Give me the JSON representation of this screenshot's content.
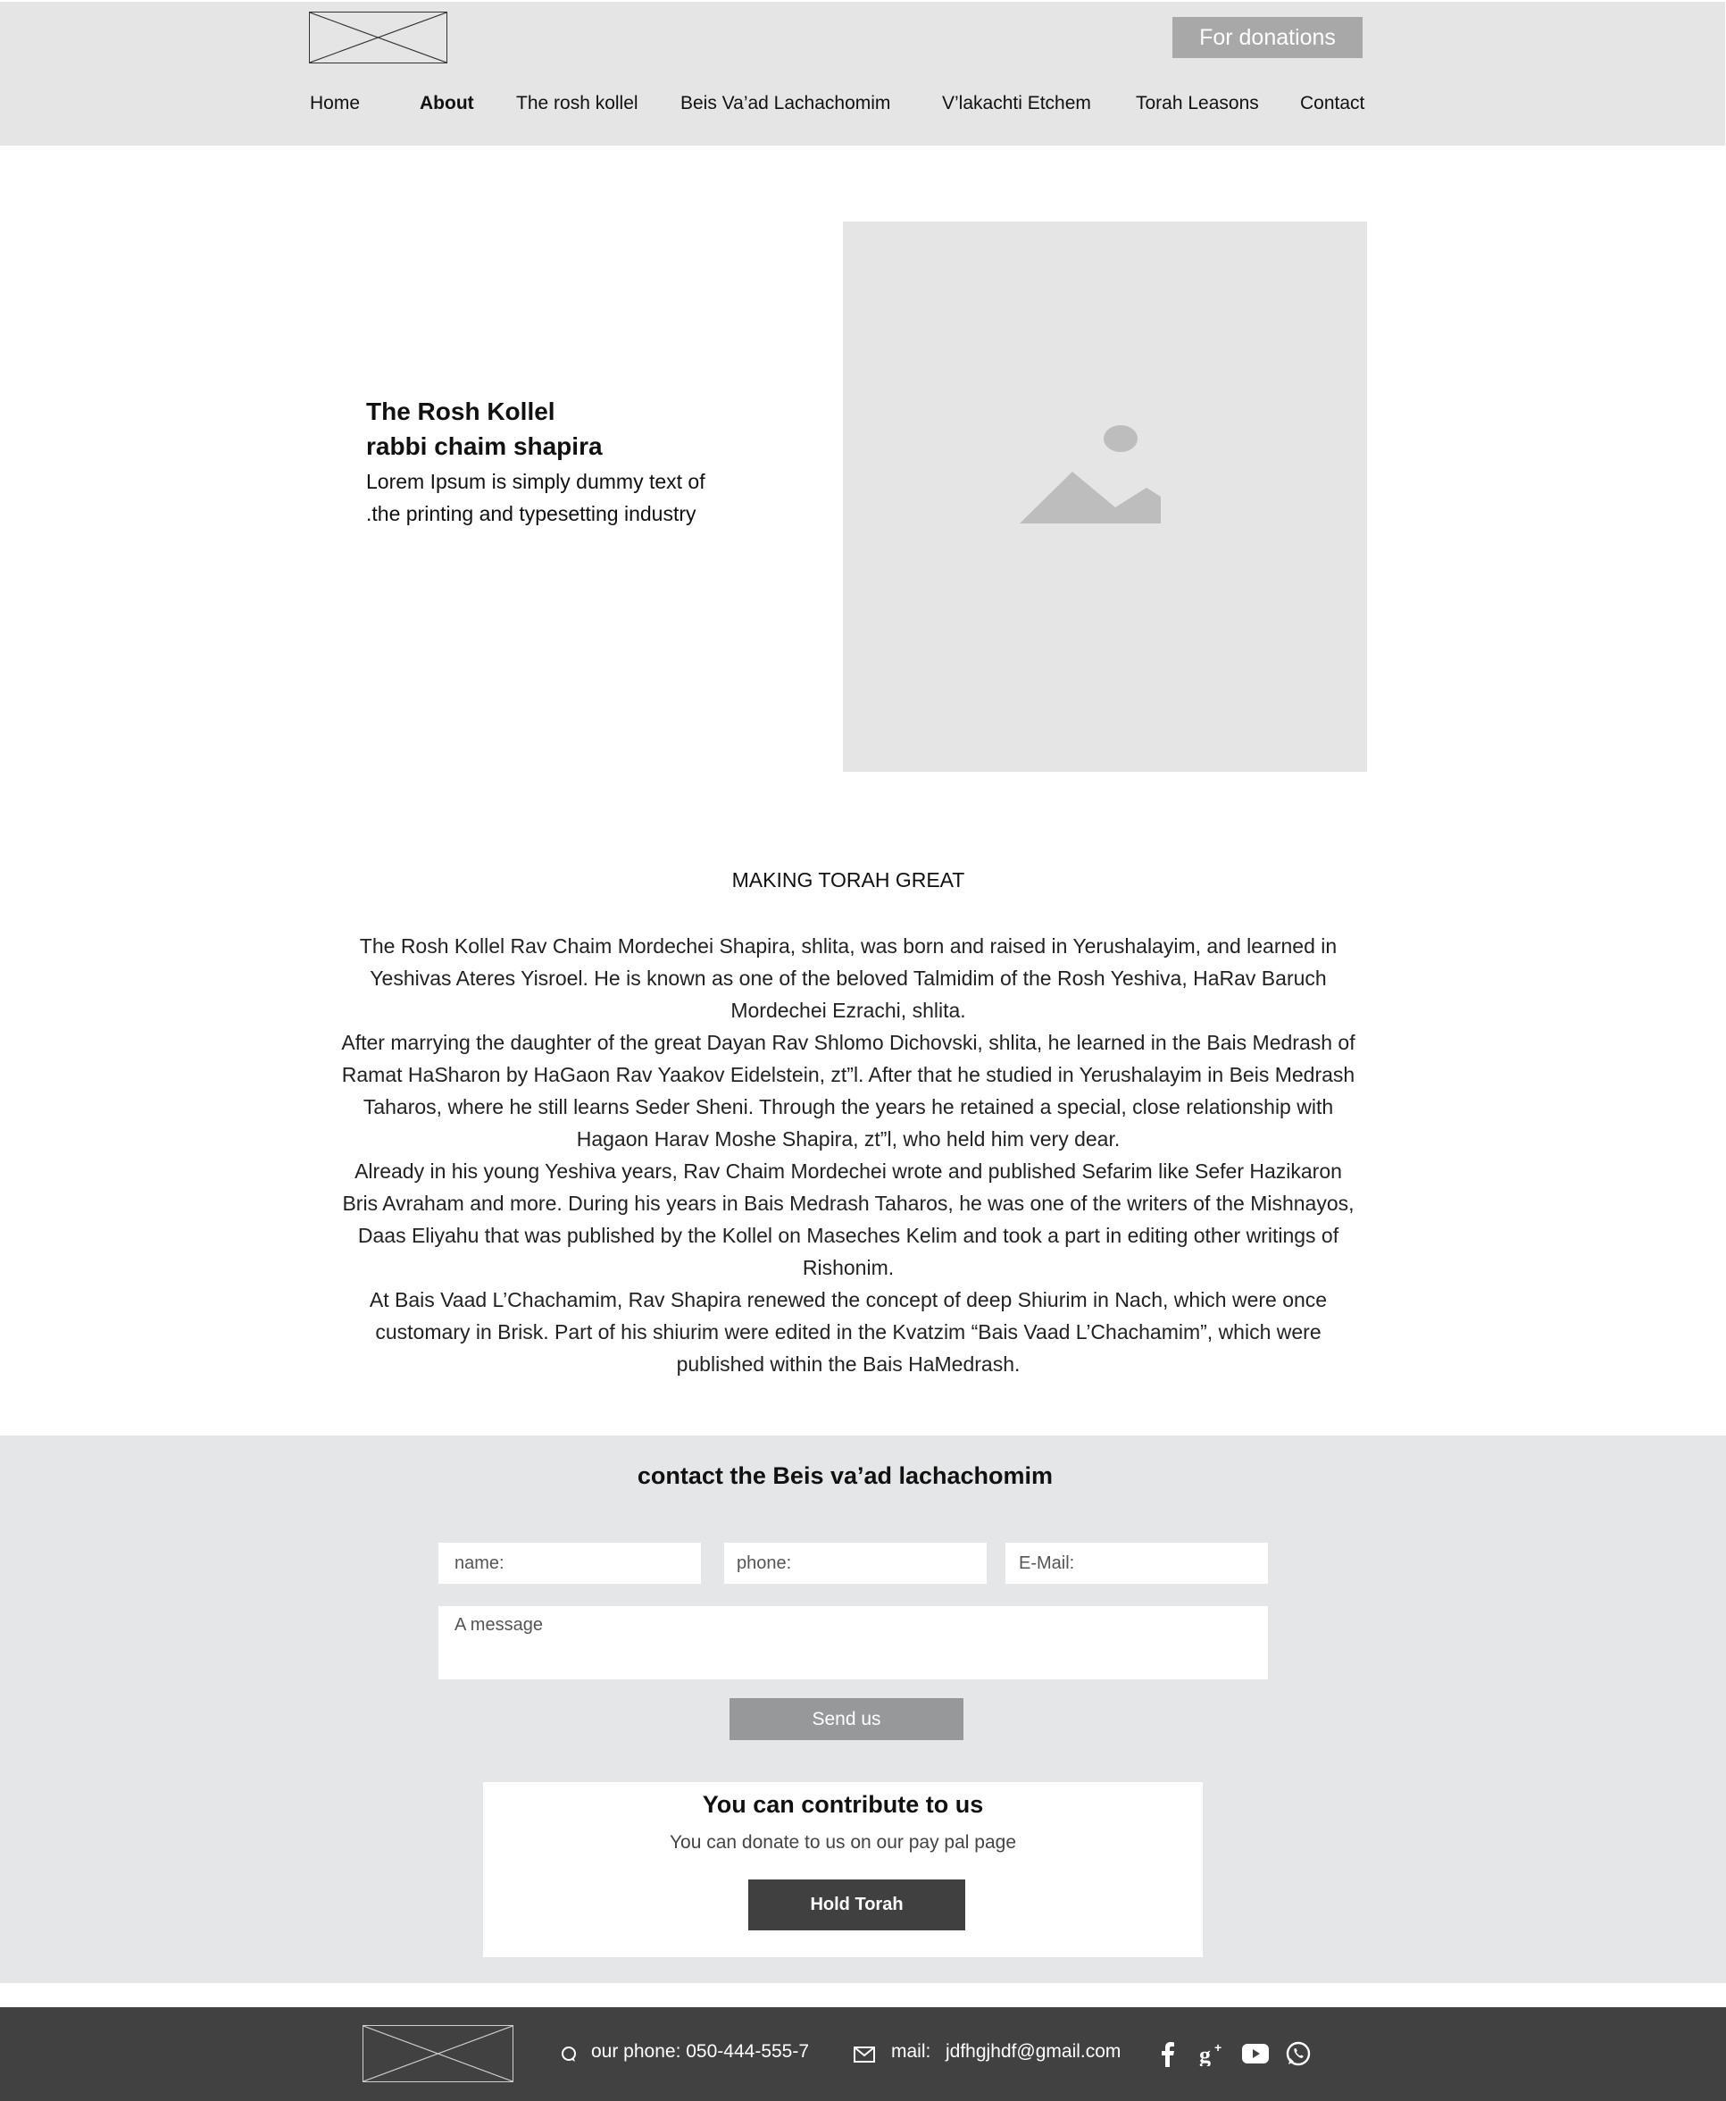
{
  "header": {
    "donate_label": "For donations",
    "nav": [
      {
        "label": "Home"
      },
      {
        "label": "About",
        "active": true
      },
      {
        "label": "The rosh kollel"
      },
      {
        "label": "Beis Va’ad Lachachomim"
      },
      {
        "label": "V’lakachti Etchem"
      },
      {
        "label": "Torah Leasons"
      },
      {
        "label": "Contact"
      }
    ]
  },
  "hero": {
    "title_line1": "The Rosh Kollel",
    "title_line2": "rabbi chaim shapira",
    "text_line1": "Lorem Ipsum is simply dummy text of",
    "text_line2": ".the printing and typesetting industry",
    "image_icon": "image-placeholder-icon"
  },
  "article": {
    "heading": "MAKING TORAH GREAT",
    "paragraphs": [
      "The Rosh Kollel Rav Chaim Mordechei Shapira, shlita, was born and raised in Yerushalayim, and learned in Yeshivas Ateres Yisroel. He is known as one of the beloved Talmidim of the Rosh Yeshiva, HaRav Baruch Mordechei Ezrachi, shlita.",
      "After marrying the daughter of the great Dayan Rav Shlomo Dichovski, shlita, he learned in the Bais Medrash of Ramat HaSharon by HaGaon Rav Yaakov Eidelstein, zt”l. After that he studied in Yerushalayim in Beis Medrash Taharos, where he still learns Seder Sheni. Through the years he retained a special, close relationship with Hagaon Harav Moshe Shapira, zt”l, who held him very dear.",
      "Already in his young Yeshiva years, Rav Chaim Mordechei wrote and published Sefarim like Sefer Hazikaron Bris Avraham and more. During his years in Bais Medrash Taharos, he was one of the writers of the Mishnayos, Daas Eliyahu that was published by the Kollel on Maseches Kelim and took a part in editing other writings of Rishonim.",
      "At Bais Vaad L’Chachamim, Rav Shapira renewed the concept of deep Shiurim in Nach, which were once customary in Brisk. Part of his shiurim were edited in the Kvatzim “Bais Vaad L’Chachamim”, which were published within the Bais HaMedrash."
    ]
  },
  "contact": {
    "heading": "contact the Beis va’ad lachachomim",
    "name_placeholder": "name:",
    "phone_placeholder": "phone:",
    "email_placeholder": "E-Mail:",
    "message_placeholder": "A message",
    "send_label": "Send us"
  },
  "contribute": {
    "title": "You can contribute to us",
    "subtitle": "You can donate to us on our pay pal page",
    "button_label": "Hold Torah"
  },
  "footer": {
    "phone_text": "our phone: 050-444-555-7",
    "mail_label": "mail:",
    "mail_value": "jdfhgjhdf@gmail.com",
    "social_icons": [
      "facebook-icon",
      "google-plus-icon",
      "youtube-icon",
      "whatsapp-icon"
    ]
  },
  "colors": {
    "header_bg": "#e5e5e5",
    "donate_bg": "#a8a8a8",
    "section_bg": "#e5e6e8",
    "send_bg": "#97989a",
    "dark_button": "#404041",
    "footer_bg": "#414142"
  }
}
